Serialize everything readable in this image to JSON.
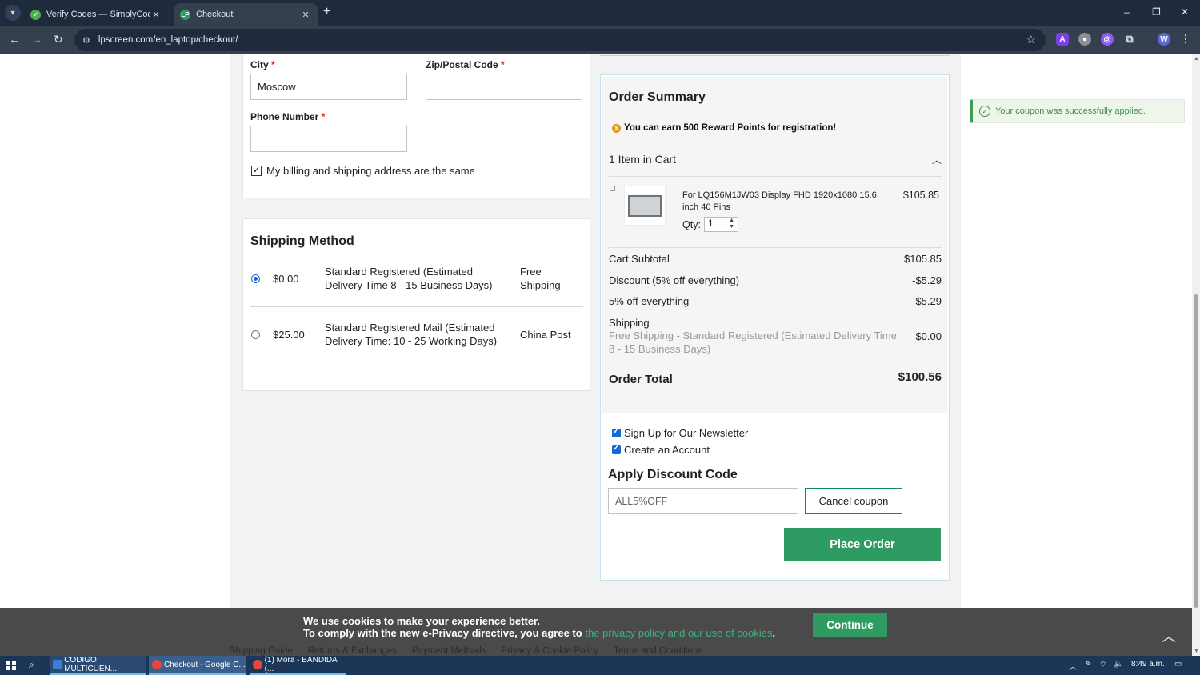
{
  "browser": {
    "tabs": [
      {
        "title": "Verify Codes — SimplyCodes",
        "active": false
      },
      {
        "title": "Checkout",
        "active": true
      }
    ],
    "url": "lpscreen.com/en_laptop/checkout/",
    "window_controls": {
      "minimize": "–",
      "restore": "❐",
      "close": "✕"
    },
    "profile_initial": "W"
  },
  "address": {
    "city_label": "City",
    "city_value": "Moscow",
    "zip_label": "Zip/Postal Code",
    "zip_value": "",
    "phone_label": "Phone Number",
    "phone_value": "",
    "required_mark": "*",
    "billing_same_label": "My billing and shipping address are the same",
    "billing_same_checked": true
  },
  "shipping": {
    "title": "Shipping Method",
    "options": [
      {
        "price": "$0.00",
        "method": "Standard Registered (Estimated Delivery Time 8 - 15 Business Days)",
        "carrier": "Free Shipping",
        "selected": true
      },
      {
        "price": "$25.00",
        "method": "Standard Registered Mail (Estimated Delivery Time: 10 - 25 Working Days)",
        "carrier": "China Post",
        "selected": false
      }
    ]
  },
  "summary": {
    "title": "Order Summary",
    "reward_prefix": "You can earn",
    "reward_points": "500 Reward Points",
    "reward_suffix": "for registration!",
    "cart_count_label": "1 Item in Cart",
    "item": {
      "name": "For LQ156M1JW03 Display FHD 1920x1080 15.6 inch 40 Pins",
      "price": "$105.85",
      "qty_label": "Qty:",
      "qty": "1"
    },
    "subtotal_label": "Cart Subtotal",
    "subtotal": "$105.85",
    "discount_label": "Discount (5% off everything)",
    "discount": "-$5.29",
    "promo_label": "5% off everything",
    "promo": "-$5.29",
    "shipping_label": "Shipping",
    "shipping_note": "Free Shipping - Standard Registered (Estimated Delivery Time 8 - 15 Business Days)",
    "shipping": "$0.00",
    "total_label": "Order Total",
    "total": "$100.56",
    "newsletter_label": "Sign Up for Our Newsletter",
    "create_account_label": "Create an Account",
    "discount_title": "Apply Discount Code",
    "coupon_code": "ALL5%OFF",
    "cancel_coupon_label": "Cancel coupon",
    "place_order_label": "Place Order"
  },
  "toast": {
    "message": "Your coupon was successfully applied."
  },
  "cookie": {
    "line1": "We use cookies to make your experience better.",
    "line2": "To comply with the new e-Privacy directive, you agree to",
    "link": "the privacy policy and our use of cookies",
    "continue_label": "Continue"
  },
  "footer_links": [
    "Shipping Guide",
    "Returns & Exchanges",
    "Payment Methods",
    "Privacy & Cookie Policy",
    "Terms and Conditions"
  ],
  "taskbar": {
    "items": [
      "CODIGO MULTICUEN...",
      "Checkout - Google C...",
      "(1) Mora - BANDIDA (..."
    ],
    "time": "8:49 a.m."
  }
}
